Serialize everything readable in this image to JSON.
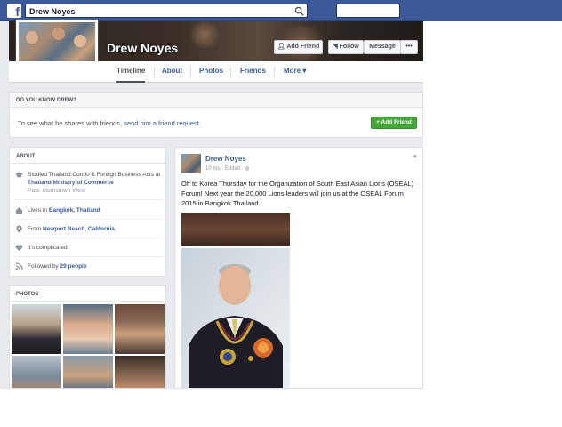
{
  "topbar": {
    "search_value": "Drew Noyes",
    "logo_letter": "f"
  },
  "profile": {
    "name": "Drew Noyes"
  },
  "cover_actions": {
    "add_friend": "Add Friend",
    "follow": "Follow",
    "message": "Message",
    "more": "•••"
  },
  "nav": {
    "tabs": [
      "Timeline",
      "About",
      "Photos",
      "Friends",
      "More ▾"
    ],
    "active": "Timeline"
  },
  "do_you_know": {
    "title": "DO YOU KNOW DREW?",
    "text_prefix": "To see what he shares with friends, ",
    "link": "send him a friend request.",
    "button": "Add Friend"
  },
  "about": {
    "title": "ABOUT",
    "study_prefix": "Studied Thailand Condo & Foreign Business Acts at ",
    "study_org": "Thailand Ministry of Commerce",
    "study_sub": "Past: Morristown West",
    "lives_prefix": "Lives in ",
    "lives_place": "Bangkok, Thailand",
    "from_prefix": "From ",
    "from_place": "Newport Beach, California",
    "relationship": "It's complicated",
    "followed_prefix": "Followed by ",
    "followed_count": "29 people"
  },
  "photos": {
    "title": "PHOTOS"
  },
  "post": {
    "author": "Drew Noyes",
    "meta": "10 hrs · Edited · ",
    "text": "Off to Korea Thursday for the Organization of South East Asian Lions (OSEAL) Forum! Next year the 20,000 Lions leaders will join us at the OSEAL Forum 2015 in Bangkok Thailand.",
    "caret": "▾"
  },
  "colors": {
    "brand": "#3b5998",
    "green_button": "#42a839",
    "page_bg": "#e9eaed"
  }
}
